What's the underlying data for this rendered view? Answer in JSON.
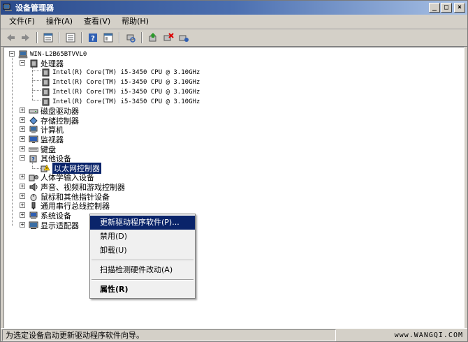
{
  "window": {
    "title": "设备管理器",
    "buttons": {
      "minimize": "_",
      "restore": "□",
      "close": "×"
    }
  },
  "menubar": [
    {
      "label": "文件(F)"
    },
    {
      "label": "操作(A)"
    },
    {
      "label": "查看(V)"
    },
    {
      "label": "帮助(H)"
    }
  ],
  "toolbar": [
    "back-icon",
    "forward-icon",
    "properties-view-icon",
    "list-icon",
    "help-icon",
    "console-icon",
    "scan-hardware-icon",
    "update-driver-icon",
    "uninstall-icon",
    "enable-icon"
  ],
  "tree": {
    "root": "WIN-L2B65BTVVL0",
    "processor": {
      "label": "处理器",
      "items": [
        "Intel(R) Core(TM) i5-3450 CPU @ 3.10GHz",
        "Intel(R) Core(TM) i5-3450 CPU @ 3.10GHz",
        "Intel(R) Core(TM) i5-3450 CPU @ 3.10GHz",
        "Intel(R) Core(TM) i5-3450 CPU @ 3.10GHz"
      ]
    },
    "categories_a": [
      "磁盘驱动器",
      "存储控制器",
      "计算机",
      "监视器",
      "键盘"
    ],
    "other_devices": {
      "label": "其他设备",
      "child": "以太网控制器"
    },
    "categories_b": [
      "人体学输入设备",
      "声音、视频和游戏控制器",
      "鼠标和其他指针设备",
      "通用串行总线控制器",
      "系统设备",
      "显示适配器"
    ]
  },
  "context_menu": {
    "update_driver": "更新驱动程序软件(P)...",
    "disable": "禁用(D)",
    "uninstall": "卸载(U)",
    "scan": "扫描检测硬件改动(A)",
    "properties": "属性(R)"
  },
  "status": {
    "text": "为选定设备启动更新驱动程序软件向导。",
    "watermark": "www.WANGQI.COM"
  }
}
